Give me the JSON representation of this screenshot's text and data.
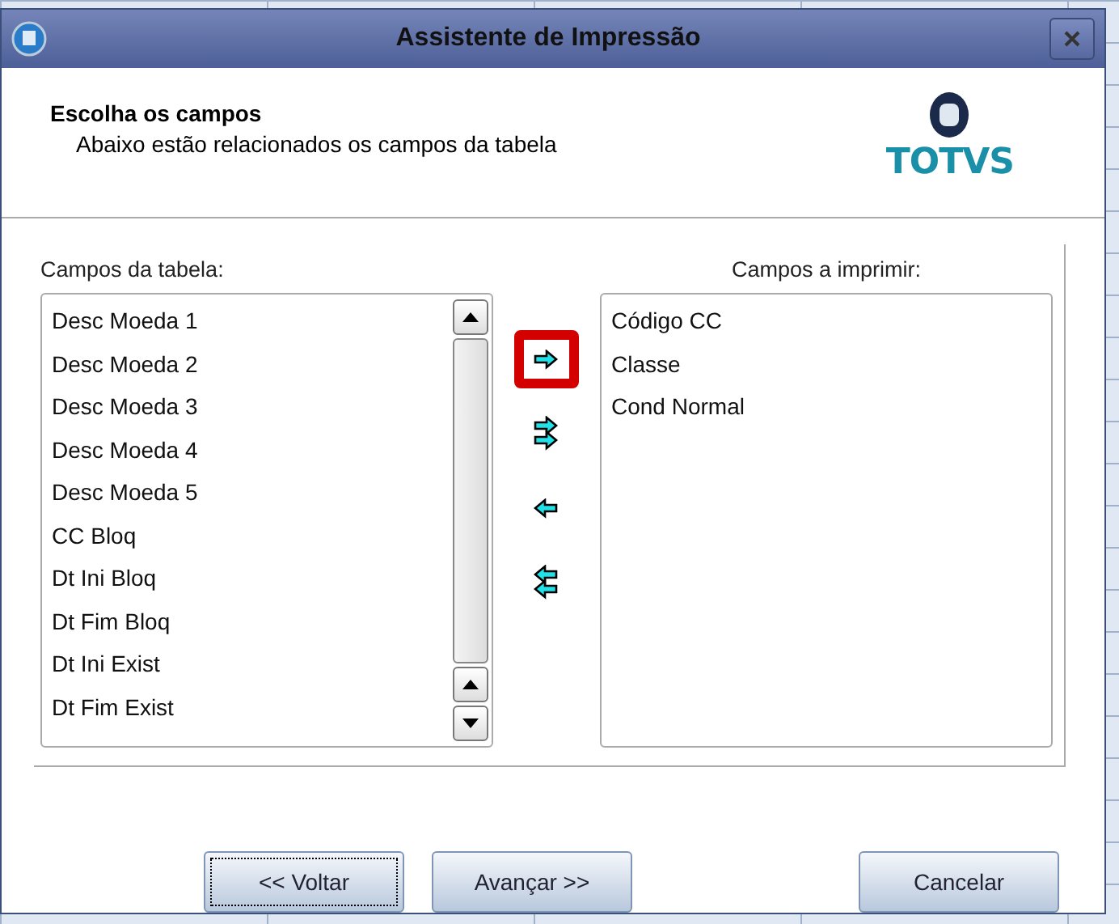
{
  "window": {
    "title": "Assistente de Impressão"
  },
  "header": {
    "heading": "Escolha os campos",
    "description": "Abaixo estão relacionados os campos da tabela",
    "logo_text": "TOTVS"
  },
  "available": {
    "label": "Campos da tabela:",
    "items": [
      "Desc Moeda 1",
      "Desc Moeda 2",
      "Desc Moeda 3",
      "Desc Moeda 4",
      "Desc Moeda 5",
      "CC Bloq",
      "Dt Ini Bloq",
      "Dt Fim Bloq",
      "Dt Ini Exist",
      "Dt Fim Exist"
    ]
  },
  "move_buttons": [
    {
      "kind": "add",
      "highlighted": true
    },
    {
      "kind": "add_all",
      "highlighted": false
    },
    {
      "kind": "remove",
      "highlighted": false
    },
    {
      "kind": "remove_all",
      "highlighted": false
    }
  ],
  "selected_fields": {
    "label": "Campos a imprimir:",
    "items": [
      "Código CC",
      "Classe",
      "Cond Normal"
    ]
  },
  "buttons": [
    {
      "label": "<< Voltar",
      "focused": true
    },
    {
      "label": "Avançar >>",
      "focused": false
    },
    {
      "label": "Cancelar",
      "focused": false
    }
  ]
}
